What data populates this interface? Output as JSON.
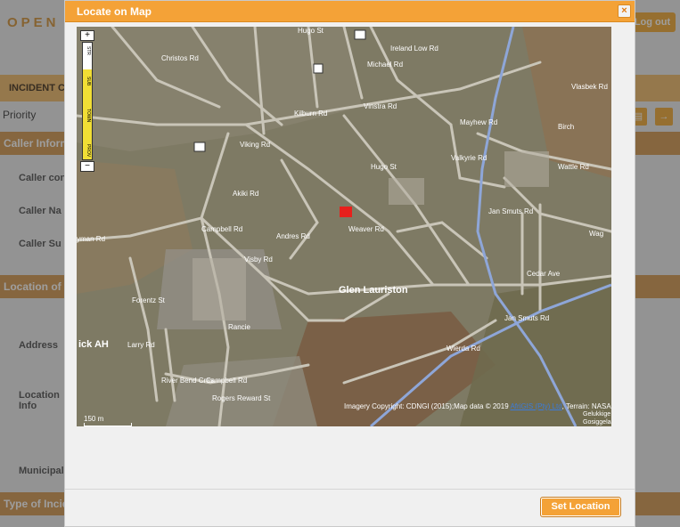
{
  "background": {
    "brand": "OPEN",
    "logout_label": "Log out",
    "incident_bar": "INCIDENT C",
    "priority_label": "Priority",
    "caller_bar": "Caller Inform",
    "caller_fields": [
      "Caller con",
      "Caller Na",
      "Caller Su"
    ],
    "location_bar": "Location of I",
    "address_label": "Address",
    "location_info_label": "Location\nInfo",
    "municipal_label": "Municipal",
    "type_bar": "Type of Incid"
  },
  "modal": {
    "title": "Locate on Map",
    "close_label": "×",
    "set_location_label": "Set Location"
  },
  "map": {
    "place_name": "Glen Lauriston",
    "area_label": "ick AH",
    "streets": [
      "Christos Rd",
      "Campbell Rd",
      "Hugo St",
      "Ireland Low Rd",
      "Michael Rd",
      "Vinstra Rd",
      "Mayhew Rd",
      "Valkyrie Rd",
      "Birch",
      "Wattle Rd",
      "Viking Rd",
      "Akiki Rd",
      "Jan Smuts Rd",
      "Wag",
      "Hugo St",
      "Weaver Rd",
      "Andres Rd",
      "Cedar Ave",
      "yman Rd",
      "Visby Rd",
      "Forentz St",
      "Larry Rd",
      "Rancie",
      "Campbell Rd",
      "River Bend Cres",
      "Rogers Reward St",
      "Wierda Rd",
      "Jan Smuts Rd",
      "Kilburn Rd",
      "Vlasbek Rd"
    ],
    "copyright_text": "Imagery Copyright: CDNGI (2015);Map data © 2019 ",
    "copyright_link": "AfriGIS (Pty) Ltd",
    "copyright_suffix": ", Terrain: NASA",
    "scale_label": "150 m",
    "corner_logo": "Gelukkige\nGosiggelaa",
    "zoom_labels": [
      "STR",
      "SUB",
      "TOWN",
      "PROV"
    ]
  },
  "colors": {
    "accent": "#f4a237",
    "marker": "#e8201c",
    "road": "#c9c9c9",
    "highway": "#8ea6d8"
  }
}
